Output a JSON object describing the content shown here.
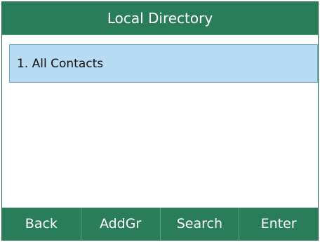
{
  "window": {
    "title": "Local Directory"
  },
  "list": {
    "items": [
      {
        "label": "1. All Contacts",
        "selected": true
      }
    ]
  },
  "softkeys": {
    "back": "Back",
    "add_group": "AddGr",
    "search": "Search",
    "enter": "Enter"
  },
  "colors": {
    "title_bar": "#2a7d5b",
    "softkey_bar": "#2a7d5b",
    "selection": "#b8dbf4",
    "selection_border": "#6fa8d6"
  }
}
